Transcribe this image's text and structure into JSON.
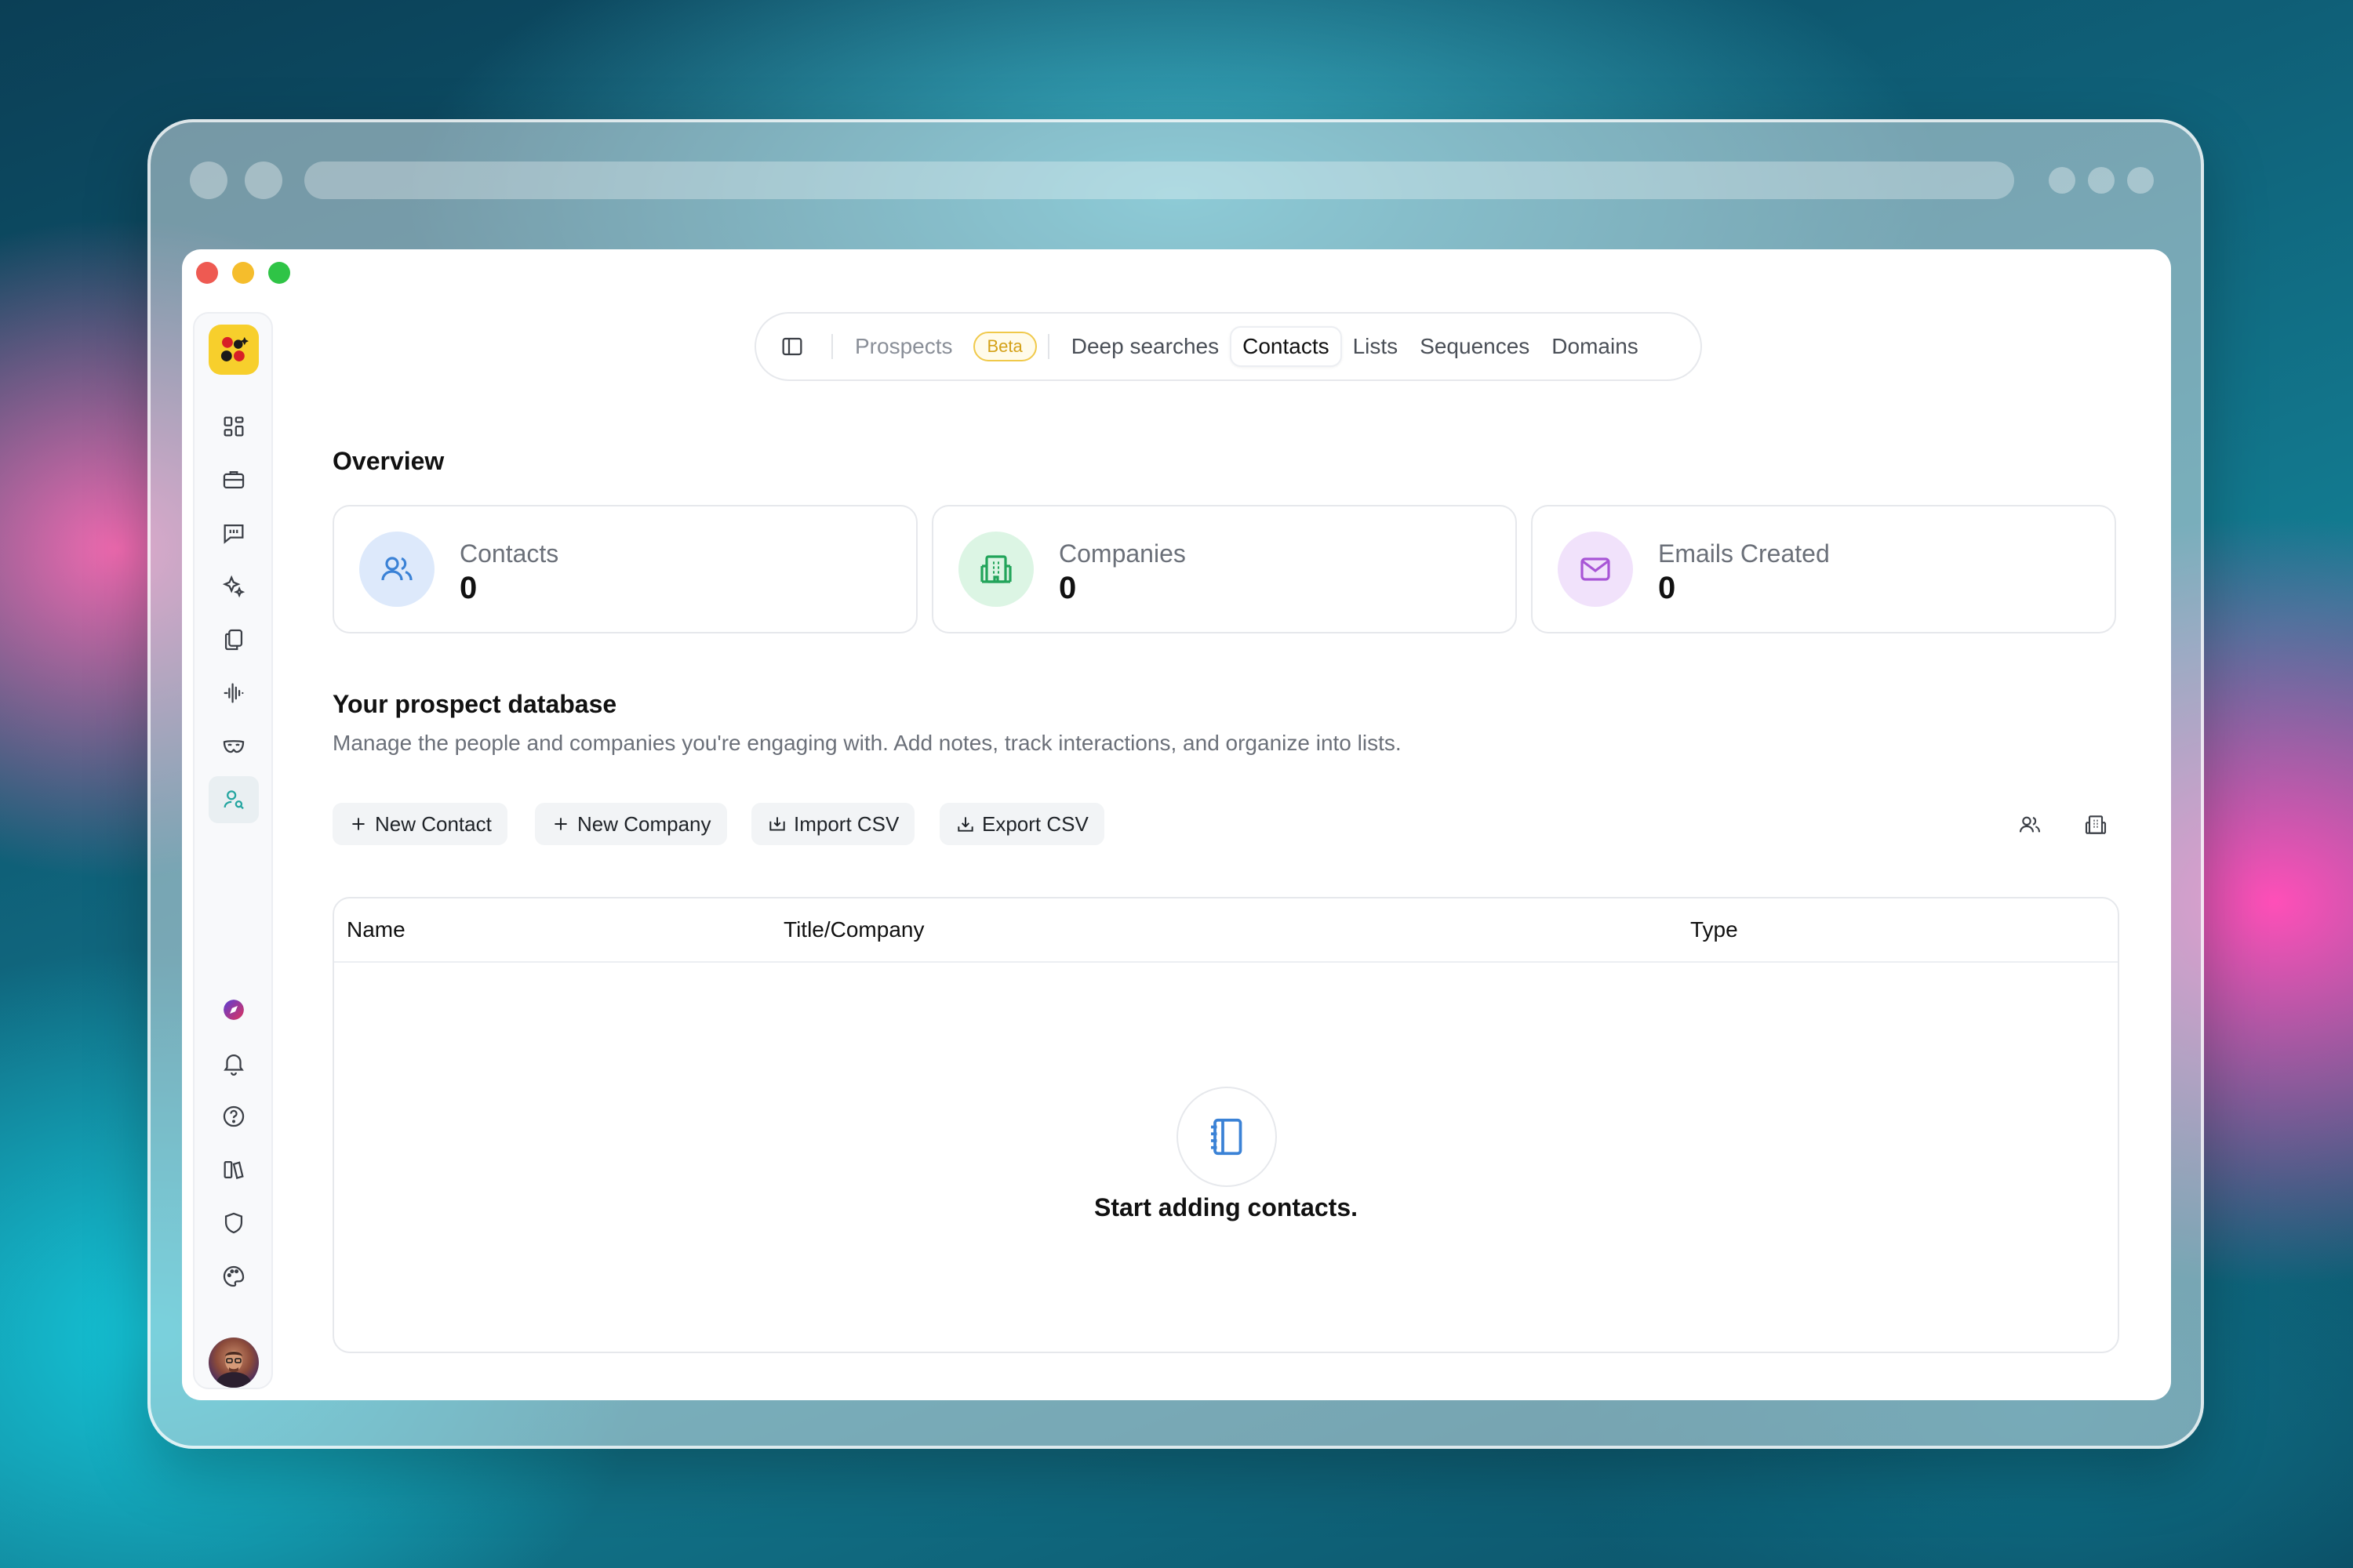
{
  "nav": {
    "tabs": [
      {
        "label": "Prospects",
        "state": "muted"
      },
      {
        "label": "Beta",
        "kind": "badge"
      },
      {
        "label": "Deep searches"
      },
      {
        "label": "Contacts",
        "state": "active"
      },
      {
        "label": "Lists"
      },
      {
        "label": "Sequences"
      },
      {
        "label": "Domains"
      }
    ]
  },
  "sidebar": {
    "top_icons": [
      "dashboard-icon",
      "briefcase-icon",
      "chat-icon",
      "sparkles-icon",
      "documents-icon",
      "waveform-icon",
      "mask-icon",
      "contact-search-icon"
    ],
    "active": "contact-search-icon",
    "bottom_icons": [
      "compass-icon",
      "bell-icon",
      "help-icon",
      "library-icon",
      "shield-icon",
      "palette-icon"
    ]
  },
  "overview": {
    "title": "Overview",
    "cards": [
      {
        "label": "Contacts",
        "value": "0",
        "color": "#3b82d6",
        "bg": "#dde9fb"
      },
      {
        "label": "Companies",
        "value": "0",
        "color": "#22a45a",
        "bg": "#dcf5e4"
      },
      {
        "label": "Emails Created",
        "value": "0",
        "color": "#a855d6",
        "bg": "#f1e2fb"
      }
    ]
  },
  "database": {
    "title": "Your prospect database",
    "subtitle": "Manage the people and companies you're engaging with. Add notes, track interactions, and organize into lists."
  },
  "actions": {
    "new_contact": "New Contact",
    "new_company": "New Company",
    "import_csv": "Import CSV",
    "export_csv": "Export CSV"
  },
  "table": {
    "columns": [
      "Name",
      "Title/Company",
      "Type"
    ],
    "empty_text": "Start adding contacts."
  },
  "colors": {
    "accent": "#23a5a0",
    "badge": "#d4a118"
  }
}
